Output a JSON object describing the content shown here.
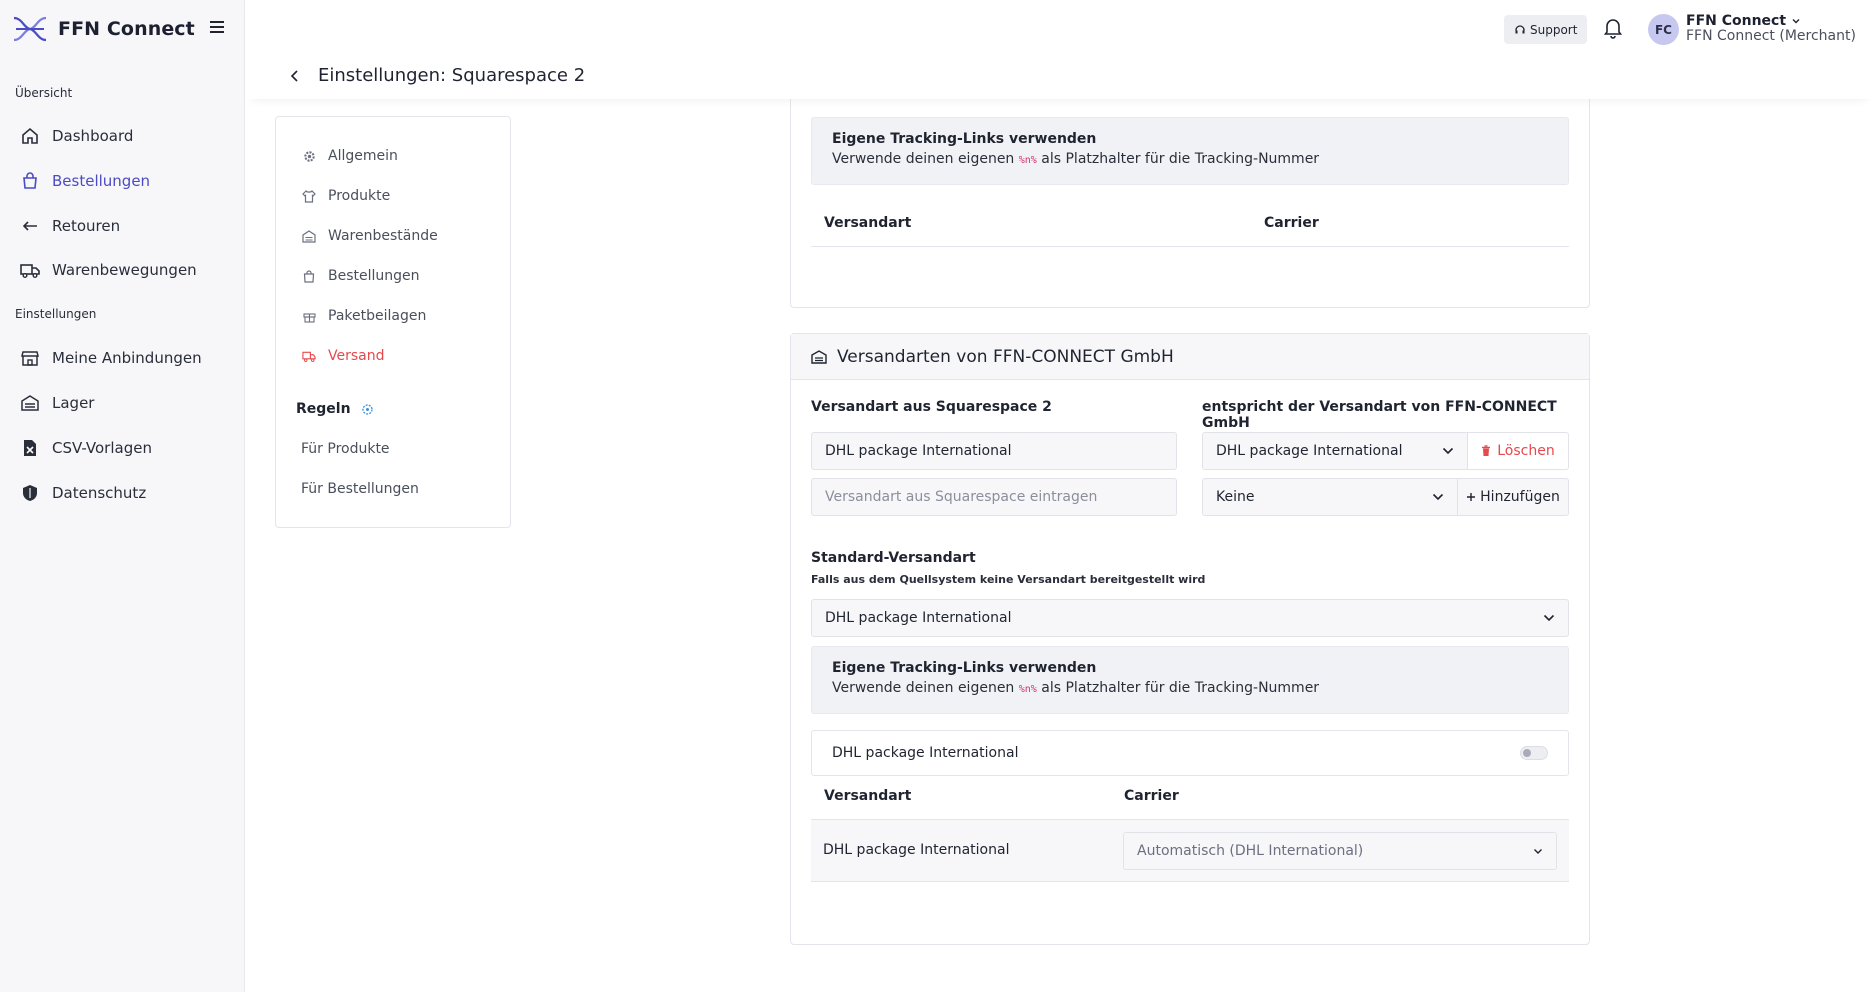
{
  "brand": {
    "name": "FFN Connect"
  },
  "sidebar": {
    "section_overview": "Übersicht",
    "section_settings": "Einstellungen",
    "items": [
      {
        "label": "Dashboard",
        "icon": "home-icon"
      },
      {
        "label": "Bestellungen",
        "icon": "shopping-bag-icon"
      },
      {
        "label": "Retouren",
        "icon": "return-arrow-icon"
      },
      {
        "label": "Warenbewegungen",
        "icon": "truck-icon"
      },
      {
        "label": "Meine Anbindungen",
        "icon": "store-icon"
      },
      {
        "label": "Lager",
        "icon": "warehouse-icon"
      },
      {
        "label": "CSV-Vorlagen",
        "icon": "csv-file-icon"
      },
      {
        "label": "Datenschutz",
        "icon": "shield-icon"
      }
    ]
  },
  "topbar": {
    "support_label": "Support",
    "avatar_initials": "FC",
    "user_name": "FFN Connect",
    "user_sub": "FFN Connect (Merchant)"
  },
  "page": {
    "title": "Einstellungen: Squarespace 2"
  },
  "settings_nav": {
    "items": [
      {
        "label": "Allgemein",
        "icon": "gear-icon"
      },
      {
        "label": "Produkte",
        "icon": "shirt-icon"
      },
      {
        "label": "Warenbestände",
        "icon": "warehouse-icon"
      },
      {
        "label": "Bestellungen",
        "icon": "bag-icon"
      },
      {
        "label": "Paketbeilagen",
        "icon": "gift-icon"
      },
      {
        "label": "Versand",
        "icon": "truck-icon"
      }
    ],
    "rules_label": "Regeln",
    "rules_items": [
      "Für Produkte",
      "Für Bestellungen"
    ]
  },
  "card1": {
    "tracking_title": "Eigene Tracking-Links verwenden",
    "tracking_desc_before": "Verwende deinen eigenen",
    "tracking_code": "%n%",
    "tracking_desc_after": "als Platzhalter für die Tracking-Nummer",
    "col_method": "Versandart",
    "col_carrier": "Carrier"
  },
  "card2": {
    "title": "Versandarten von FFN-CONNECT GmbH",
    "label_source": "Versandart aus Squarespace 2",
    "label_target": "entspricht der Versandart von FFN-CONNECT GmbH",
    "row1_source": "DHL package International",
    "row1_target": "DHL package International",
    "delete_label": "Löschen",
    "row2_placeholder": "Versandart aus Squarespace eintragen",
    "row2_target": "Keine",
    "add_label": "Hinzufügen",
    "default_label": "Standard-Versandart",
    "default_hint": "Falls aus dem Quellsystem keine Versandart bereitgestellt wird",
    "default_value": "DHL package International",
    "tracking_title": "Eigene Tracking-Links verwenden",
    "tracking_desc_before": "Verwende deinen eigenen",
    "tracking_code": "%n%",
    "tracking_desc_after": "als Platzhalter für die Tracking-Nummer",
    "toggle_label": "DHL package International",
    "toggle_on": false,
    "col_method": "Versandart",
    "col_carrier": "Carrier",
    "row_method": "DHL package International",
    "row_carrier": "Automatisch (DHL International)"
  },
  "colors": {
    "accent": "#4b4bc4",
    "danger": "#e5484d"
  }
}
